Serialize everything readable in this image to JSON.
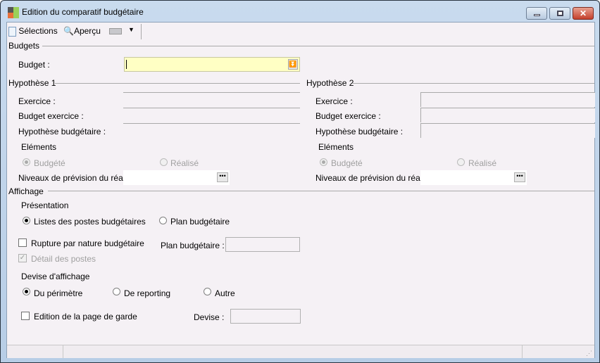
{
  "window": {
    "title": "Edition du comparatif budgétaire"
  },
  "toolbar": {
    "selections": "Sélections",
    "apercu": "Aperçu"
  },
  "budgets": {
    "section": "Budgets",
    "budget_label": "Budget :",
    "budget_value": ""
  },
  "h1": {
    "section": "Hypothèse 1",
    "exercice": "Exercice :",
    "budget_exercice": "Budget exercice :",
    "hypothese": "Hypothèse budgétaire :",
    "elements": "Eléments",
    "budgete": "Budgété",
    "realise": "Réalisé",
    "niveaux": "Niveaux de prévision du réalisé"
  },
  "h2": {
    "section": "Hypothèse 2",
    "exercice": "Exercice :",
    "budget_exercice": "Budget exercice :",
    "hypothese": "Hypothèse budgétaire :",
    "elements": "Eléments",
    "budgete": "Budgété",
    "realise": "Réalisé",
    "niveaux": "Niveaux de prévision du réalisé"
  },
  "affichage": {
    "section": "Affichage",
    "presentation": "Présentation",
    "listes": "Listes des postes budgétaires",
    "plan": "Plan budgétaire",
    "rupture": "Rupture par nature budgétaire",
    "plan_label": "Plan budgétaire :",
    "detail": "Détail des postes",
    "devise_section": "Devise d'affichage",
    "perimetre": "Du périmètre",
    "reporting": "De reporting",
    "autre": "Autre",
    "page_garde": "Edition de la page de garde",
    "devise_label": "Devise :"
  }
}
